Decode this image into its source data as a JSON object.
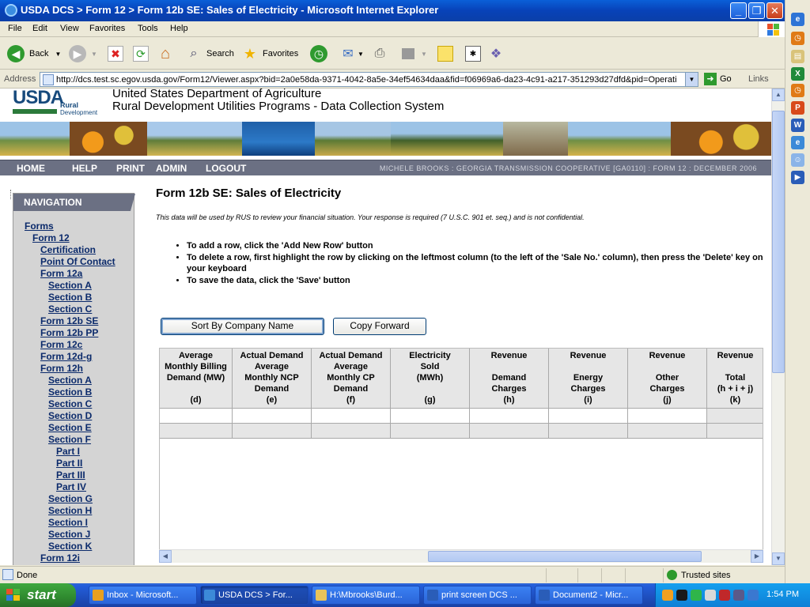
{
  "window": {
    "title": "USDA DCS > Form 12 > Form 12b SE: Sales of Electricity - Microsoft Internet Explorer"
  },
  "menu": [
    "File",
    "Edit",
    "View",
    "Favorites",
    "Tools",
    "Help"
  ],
  "toolbar": {
    "back": "Back",
    "search": "Search",
    "favorites": "Favorites"
  },
  "address": {
    "label": "Address",
    "url": "http://dcs.test.sc.egov.usda.gov/Form12/Viewer.aspx?bid=2a0e58da-9371-4042-8a5e-34ef54634daa&fid=f06969a6-da23-4c91-a217-351293d27dfd&pid=Operati",
    "go": "Go",
    "links": "Links"
  },
  "header": {
    "logo_word": "USDA",
    "logo_rural": "Rural",
    "logo_dev": "Development",
    "line1": "United States Department of Agriculture",
    "line2": "Rural Development Utilities Programs - Data Collection System"
  },
  "navbar": {
    "links": [
      "HOME",
      "HELP",
      "PRINT",
      "ADMIN",
      "LOGOUT"
    ],
    "context": "MICHELE BROOKS : GEORGIA TRANSMISSION COOPERATIVE [GA0110] : FORM 12 : DECEMBER 2006"
  },
  "navigation": {
    "title": "NAVIGATION",
    "items": [
      {
        "label": "Forms",
        "level": 0
      },
      {
        "label": "Form 12",
        "level": 1
      },
      {
        "label": "Certification",
        "level": 2
      },
      {
        "label": "Point Of Contact",
        "level": 2
      },
      {
        "label": "Form 12a",
        "level": 2
      },
      {
        "label": "Section A",
        "level": 3
      },
      {
        "label": "Section B",
        "level": 3
      },
      {
        "label": "Section C",
        "level": 3
      },
      {
        "label": "Form 12b SE",
        "level": 2
      },
      {
        "label": "Form 12b PP",
        "level": 2
      },
      {
        "label": "Form 12c",
        "level": 2
      },
      {
        "label": "Form 12d-g",
        "level": 2
      },
      {
        "label": "Form 12h",
        "level": 2
      },
      {
        "label": "Section A",
        "level": 3
      },
      {
        "label": "Section B",
        "level": 3
      },
      {
        "label": "Section C",
        "level": 3
      },
      {
        "label": "Section D",
        "level": 3
      },
      {
        "label": "Section E",
        "level": 3
      },
      {
        "label": "Section F",
        "level": 3
      },
      {
        "label": "Part I",
        "level": 4
      },
      {
        "label": "Part II",
        "level": 4
      },
      {
        "label": "Part III",
        "level": 4
      },
      {
        "label": "Part IV",
        "level": 4
      },
      {
        "label": "Section G",
        "level": 3
      },
      {
        "label": "Section H",
        "level": 3
      },
      {
        "label": "Section I",
        "level": 3
      },
      {
        "label": "Section J",
        "level": 3
      },
      {
        "label": "Section K",
        "level": 3
      },
      {
        "label": "Form 12i",
        "level": 2
      }
    ]
  },
  "content": {
    "title": "Form 12b SE: Sales of Electricity",
    "notice": "This data will be used by RUS to review your financial situation. Your response is required (7 U.S.C. 901 et. seq.) and is not confidential.",
    "instructions": [
      "To add a row, click the 'Add New Row' button",
      "To delete a row, first highlight the row by clicking on the leftmost column (to the left of the 'Sale No.' column), then press the 'Delete' key on your keyboard",
      "To save the data, click the 'Save' button"
    ],
    "buttons": {
      "sort": "Sort By Company Name",
      "copy": "Copy Forward"
    }
  },
  "grid": {
    "columns": [
      "Average\nMonthly Billing\nDemand (MW)\n\n(d)",
      "Actual Demand\nAverage\nMonthly NCP\nDemand\n(e)",
      "Actual Demand\nAverage\nMonthly CP\nDemand\n(f)",
      "Electricity\nSold\n(MWh)\n\n(g)",
      "Revenue\n\nDemand\nCharges\n(h)",
      "Revenue\n\nEnergy\nCharges\n(i)",
      "Revenue\n\nOther\nCharges\n(j)",
      "Revenue\n\nTotal\n(h + i + j)\n(k)"
    ]
  },
  "status": {
    "text": "Done",
    "zone": "Trusted sites"
  },
  "taskbar": {
    "start": "start",
    "tasks": [
      "Inbox - Microsoft...",
      "USDA DCS > For...",
      "H:\\Mbrooks\\Burd...",
      "print screen DCS ...",
      "Document2 - Micr..."
    ],
    "clock": "1:54 PM"
  },
  "colors": {
    "nav_bar": "#6b7083",
    "nav_link": "#0b2a6b",
    "xp_blue": "#0842b8",
    "start_green": "#2f8a2f"
  }
}
